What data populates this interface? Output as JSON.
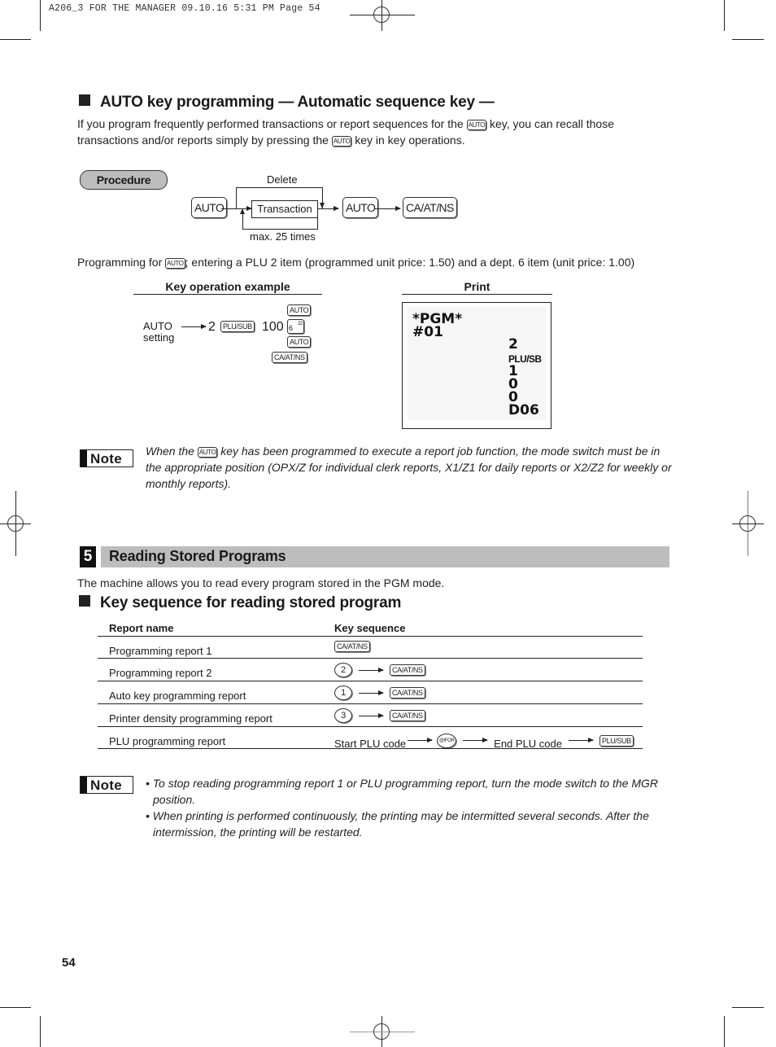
{
  "slug": "A206_3 FOR THE MANAGER  09.10.16 5:31 PM  Page 54",
  "auto_key": {
    "heading": "AUTO key programming — Automatic sequence key —",
    "intro_part1": "If you program frequently performed transactions or report sequences for the",
    "intro_part2": "key, you can recall those",
    "intro_part3": "transactions and/or reports simply by pressing the",
    "intro_part4": "key in key operations.",
    "procedure_label": "Procedure",
    "diagram": {
      "start_key": "AUTO",
      "delete_label": "Delete",
      "transaction_label": "Transaction",
      "loop_label": "max. 25 times",
      "mid_key": "AUTO",
      "end_key": "CA/AT/NS"
    },
    "example_part1": "Programming for",
    "example_part2": "; entering a PLU 2 item (programmed unit price: 1.50) and a dept. 6 item (unit price: 1.00)",
    "key_op_heading": "Key operation example",
    "print_heading": "Print",
    "key_op": {
      "mode_line1": "AUTO",
      "mode_line2": "setting",
      "plu_number": "2",
      "plu_key": "PLU/SUB",
      "amount": "100",
      "keys_stack": [
        "AUTO",
        "6",
        "AUTO",
        "CA/AT/NS"
      ],
      "dept_key_superscript": "22"
    },
    "receipt_lines": {
      "title": "*PGM*",
      "number": "#01",
      "plu": "2",
      "plu_label": "PLU/SB",
      "d1": "1",
      "d2": "0",
      "d3": "0",
      "dept": "D06"
    },
    "note_label": "Note",
    "note_part1": "When the",
    "note_part2": "key has been programmed to execute a report job function, the mode switch must be in the appropriate position (OPX/Z for individual clerk reports, X1/Z1 for daily reports or X2/Z2 for weekly or monthly reports).",
    "auto_key_glyph": "AUTO"
  },
  "section5": {
    "number": "5",
    "title": "Reading Stored Programs",
    "intro": "The machine allows you to read every program stored in the PGM mode.",
    "subheading": "Key sequence for reading stored program",
    "table": {
      "headers": [
        "Report name",
        "Key sequence"
      ],
      "rows": [
        {
          "name": "Programming report 1",
          "prefix": "",
          "key": "CA/AT/NS"
        },
        {
          "name": "Programming report 2",
          "prefix": "2",
          "key": "CA/AT/NS"
        },
        {
          "name": "Auto key programming report",
          "prefix": "1",
          "key": "CA/AT/NS"
        },
        {
          "name": "Printer density programming report",
          "prefix": "3",
          "key": "CA/AT/NS"
        },
        {
          "name": "PLU programming report",
          "start": "Start PLU code",
          "mid_key": "@/FOR",
          "end": "End PLU code",
          "key": "PLU/SUB"
        }
      ]
    },
    "note_label": "Note",
    "notes": [
      "• To stop reading programming report 1 or PLU programming report, turn the mode switch to the MGR position.",
      "• When printing is performed continuously, the printing may be intermitted several seconds.  After the intermission, the printing will be restarted."
    ]
  },
  "page_number": "54"
}
